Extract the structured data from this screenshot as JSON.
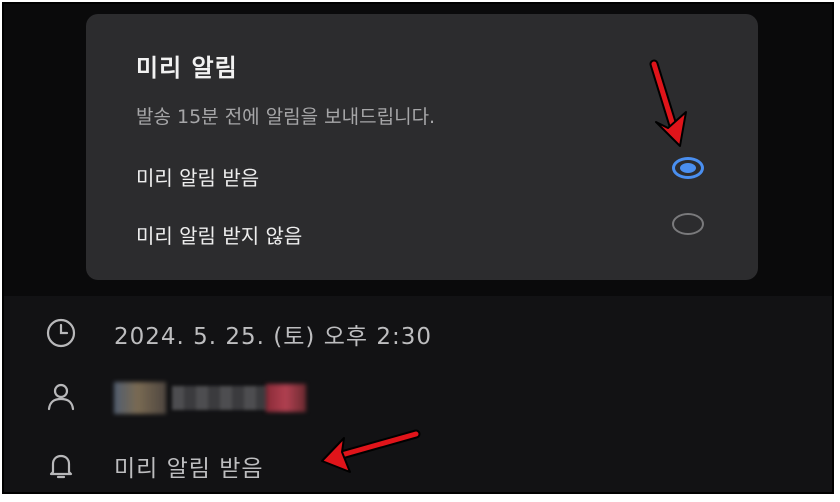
{
  "dialog": {
    "title": "미리 알림",
    "description": "발송 15분 전에 알림을 보내드립니다.",
    "options": [
      {
        "label": "미리 알림 받음",
        "selected": true
      },
      {
        "label": "미리 알림 받지 않음",
        "selected": false
      }
    ]
  },
  "details": {
    "datetime": "2024. 5. 25. (토) 오후 2:30",
    "reminder": "미리 알림 받음"
  },
  "icons": {
    "clock": "clock-icon",
    "person": "person-icon",
    "bell": "bell-icon",
    "arrow": "red-arrow-annotation"
  },
  "colors": {
    "accent": "#4a8ff0",
    "annotation": "#e0141a",
    "dialog_bg": "#2c2c2e",
    "page_bg": "#0e0e10"
  }
}
